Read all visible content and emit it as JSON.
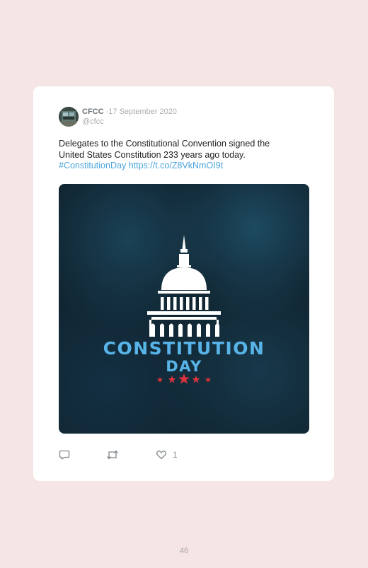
{
  "tweet": {
    "author_name": "CFCC",
    "separator": "·",
    "date": "17 September 2020",
    "handle": "@cfcc",
    "text_line1": "Delegates to the Constitutional Convention signed the",
    "text_line2": "United States Constitution 233 years ago today.",
    "hashtag": "#ConstitutionDay",
    "link": "https://t.co/Z8VkNmOI9t",
    "image_title_line1": "CONSTITUTION",
    "image_title_line2": "DAY",
    "like_count": "1"
  },
  "icons": [
    "reply-icon",
    "retweet-icon",
    "heart-icon",
    "capitol-dome-icon",
    "star-icon"
  ],
  "colors": {
    "background": "#f5e5e4",
    "card": "#ffffff",
    "link": "#4aa5dc",
    "image_title": "#58b4e8",
    "stars": "#e0323c"
  },
  "page": {
    "number": "46"
  }
}
